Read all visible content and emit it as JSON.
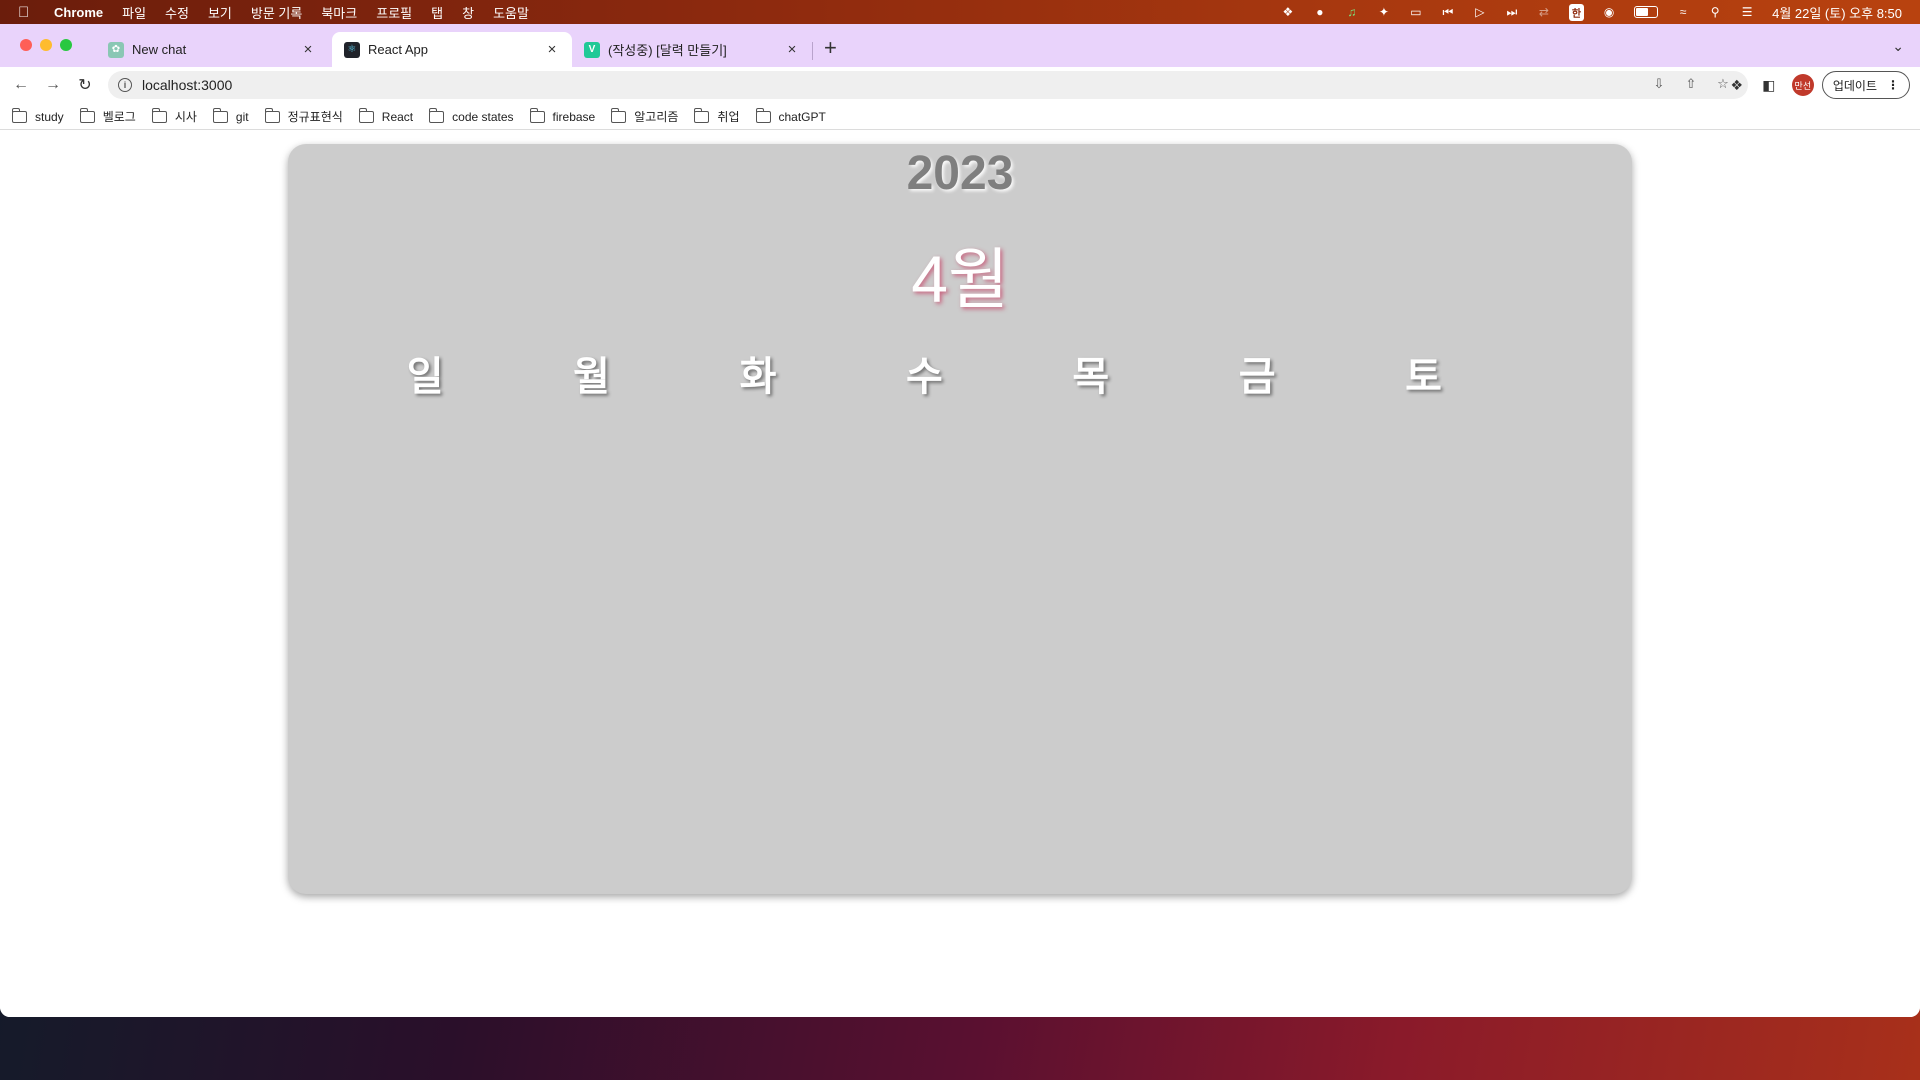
{
  "menubar": {
    "apple_icon": "apple-icon",
    "items": [
      "Chrome",
      "파일",
      "수정",
      "보기",
      "방문 기록",
      "북마크",
      "프로필",
      "탭",
      "창",
      "도움말"
    ],
    "status_icons": [
      "figma-icon",
      "chat-bubble-icon",
      "music-note-icon",
      "spark-icon",
      "screen-mirror-icon",
      "previous-track-icon",
      "play-icon",
      "next-track-icon",
      "shuffle-icon"
    ],
    "input_source": "한",
    "clock": "4월 22일 (토) 오후 8:50"
  },
  "tabs": [
    {
      "title": "New chat",
      "favicon_color": "#8ac7b4"
    },
    {
      "title": "React App",
      "favicon_color": "#20232a"
    },
    {
      "title": "(작성중) [달력 만들기]",
      "favicon_letter": "V",
      "favicon_color": "#20c997"
    }
  ],
  "address_bar": {
    "url": "localhost:3000"
  },
  "profile": {
    "label": "만선"
  },
  "update_button": {
    "label": "업데이트"
  },
  "bookmarks": [
    "study",
    "벨로그",
    "시사",
    "git",
    "정규표현식",
    "React",
    "code states",
    "firebase",
    "알고리즘",
    "취업",
    "chatGPT"
  ],
  "calendar": {
    "year": "2023",
    "month": "4월",
    "weekdays": [
      "일",
      "월",
      "화",
      "수",
      "목",
      "금",
      "토"
    ]
  }
}
